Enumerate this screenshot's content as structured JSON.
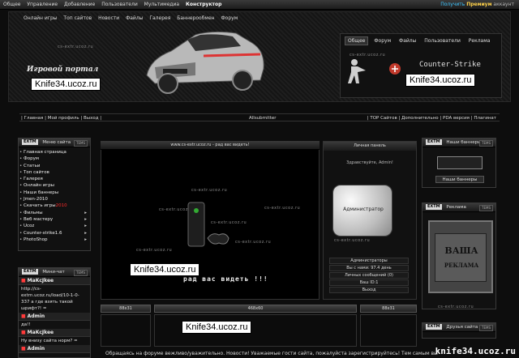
{
  "admin_bar": {
    "items": [
      "Общее",
      "Управление",
      "Добавление",
      "Пользователи",
      "Мультимедиа"
    ],
    "constructor": "Конструктор",
    "right_prefix": "Получить",
    "premium": "Премиум",
    "right_suffix": "аккаунт"
  },
  "header": {
    "nav": [
      "Онлайн игры",
      "Топ сайтов",
      "Новости",
      "Файлы",
      "Галерея",
      "Баннерообмен",
      "Форум"
    ],
    "portal_title": "Игровой портал",
    "right_tabs": [
      "Общее",
      "Форум",
      "Файлы",
      "Пользователи",
      "Реклама"
    ],
    "cs_logo": "Counter-Strike",
    "watermark_small": "cs-extr.ucoz.ru"
  },
  "overlays": {
    "knife_1": "Knife34.ucoz.ru",
    "knife_2": "Knife34.ucoz.ru",
    "knife_3": "Knife34.ucoz.ru",
    "knife_4": "Knife34.ucoz.ru",
    "corner": "knife34.ucoz.ru"
  },
  "breadcrumb": {
    "left": "| Главная | Мой профиль | Выход |",
    "center": "Allsubmitter",
    "right": "| TOP Сайтов | Дополнительно | PDA версия | Плагинат"
  },
  "left_menu": {
    "badge": "EXTM",
    "title": "Меню сайта",
    "tag": "TEMS",
    "items": [
      {
        "label": "Главная страница",
        "arrow": ""
      },
      {
        "label": "Форум",
        "arrow": ""
      },
      {
        "label": "Статьи",
        "arrow": ""
      },
      {
        "label": "Топ сайтов",
        "arrow": ""
      },
      {
        "label": "Галерея",
        "arrow": ""
      },
      {
        "label": "Онлайн игры",
        "arrow": ""
      },
      {
        "label": "Наши баннеры",
        "arrow": ""
      },
      {
        "label": "Jmen-2010",
        "arrow": ""
      },
      {
        "label": "Скачать игры",
        "red": "2010",
        "arrow": ""
      },
      {
        "label": "Фильмы",
        "arrow": "▸"
      },
      {
        "label": "Веб мастеру",
        "arrow": "▸"
      },
      {
        "label": "Ucoz",
        "arrow": "▸"
      },
      {
        "label": "Counter-strike1.6",
        "arrow": "▸"
      },
      {
        "label": "PhotoShop",
        "arrow": "▸"
      }
    ]
  },
  "mini_chat": {
    "badge": "EXTM",
    "title": "Мини-чат",
    "tag": "TEMS",
    "messages": [
      {
        "nick": "MaKcJkee",
        "text": "http://cs-extrn.ucoz.ru/load/10-1-0-337 а где взять такой шрифт?! ="
      },
      {
        "nick": "Admin",
        "text": "да!!"
      },
      {
        "nick": "MaKcJkee",
        "text": "Ну внизу сайта норм? ="
      },
      {
        "nick": "Admin",
        "text": ""
      }
    ]
  },
  "center": {
    "title": "www.cs-extr.ucoz.ru - рад вас видеть!",
    "watermark": "cs-extr.ucoz.ru",
    "banner_text": "рад вас видеть !!!"
  },
  "login_panel": {
    "title": "Личная панель",
    "greeting": "Здравствуйте, Admin!",
    "role": "Администратор",
    "rows": [
      "Администраторы",
      "Вы с нами: 97.4 день",
      "Личных сообщений (0)",
      "Ваш ID:1",
      "Выход"
    ]
  },
  "right_col": {
    "banners_block": {
      "badge": "EXTM",
      "title": "Наши баннеры",
      "tag": "TEMS",
      "button": "Наши баннеры"
    },
    "ads_block": {
      "badge": "EXTM",
      "title": "Реклама",
      "tag": "TEMS",
      "ad_line1": "ВАША",
      "ad_line2": "РЕКЛАМА",
      "footer": "cs-extr.ucoz.ru"
    },
    "friends_block": {
      "badge": "EXTM",
      "title": "Друзья сайта",
      "tag": "TEMS"
    }
  },
  "ad_bars": {
    "left": "88x31",
    "center": "468x60",
    "right": "88x31"
  },
  "notice": "Обращаясь на форуме вежливо/уважительно. Новости! Уважаемые гости сайта, пожалуйста зарегистрируйтесь! Тем самым вы"
}
